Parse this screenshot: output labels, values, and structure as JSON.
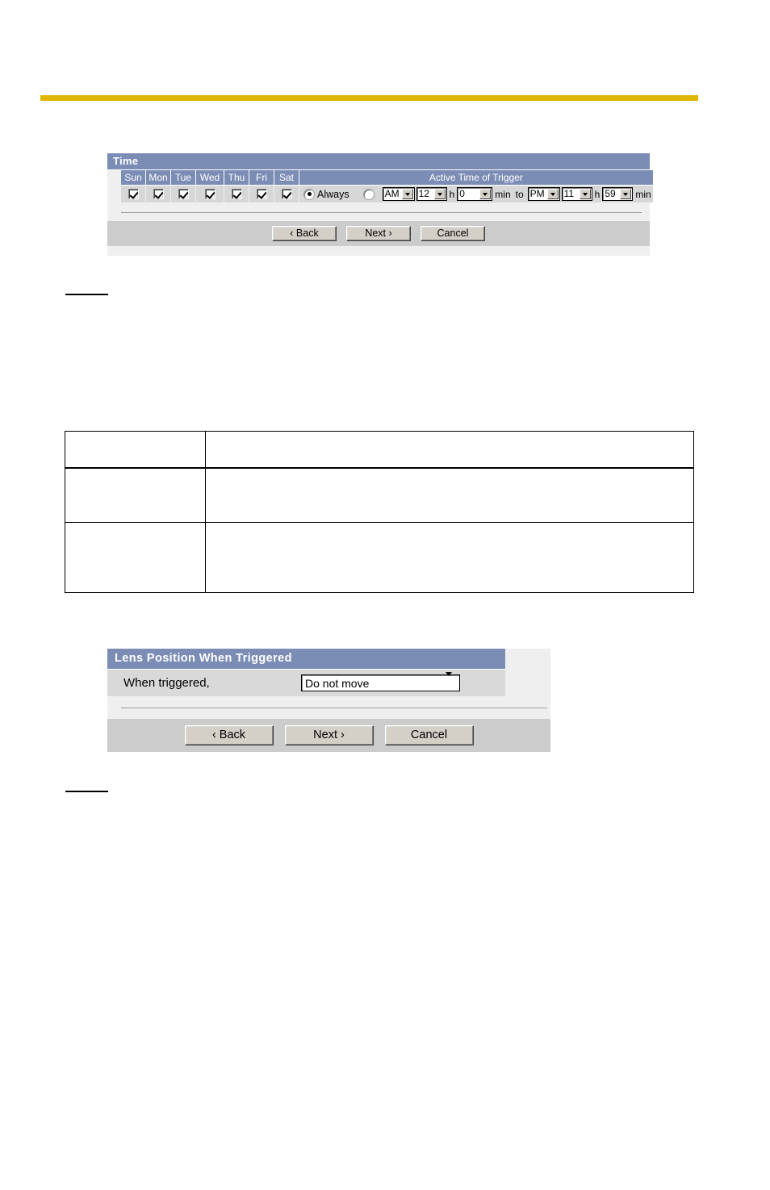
{
  "page": {
    "accent_gold": "#dfb600",
    "panel_header_blue": "#7b8cb5",
    "panel_bg": "#efefef",
    "row_bg": "#d7d7d7",
    "button_bar_bg": "#cccccc"
  },
  "time_panel": {
    "title": "Time",
    "day_headers": [
      "Sun",
      "Mon",
      "Tue",
      "Wed",
      "Thu",
      "Fri",
      "Sat"
    ],
    "day_checked": [
      true,
      true,
      true,
      true,
      true,
      true,
      true
    ],
    "active_time_header": "Active Time of Trigger",
    "always_label": "Always",
    "always_selected": true,
    "range_selected": false,
    "start": {
      "meridiem": "AM",
      "hour": "12",
      "hour_unit": "h",
      "minute": "0",
      "minute_unit": "min"
    },
    "to_label": "to",
    "end": {
      "meridiem": "PM",
      "hour": "11",
      "hour_unit": "h",
      "minute": "59",
      "minute_unit": "min"
    },
    "buttons": {
      "back": "‹ Back",
      "next": "Next ›",
      "cancel": "Cancel"
    }
  },
  "reference_table": {
    "rows": [
      {
        "label": "",
        "description": ""
      },
      {
        "label": "",
        "description": ""
      },
      {
        "label": "",
        "description": ""
      }
    ]
  },
  "lens_panel": {
    "title": "Lens Position When Triggered",
    "field_label": "When triggered,",
    "selected_option": "Do not move",
    "buttons": {
      "back": "‹ Back",
      "next": "Next ›",
      "cancel": "Cancel"
    }
  },
  "notes": {
    "note_1": "",
    "note_2": ""
  }
}
